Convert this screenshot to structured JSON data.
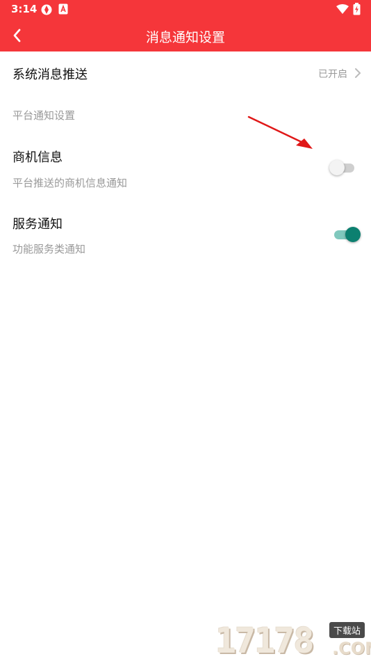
{
  "status_bar": {
    "time": "3:14"
  },
  "app_bar": {
    "title": "消息通知设置"
  },
  "system_push": {
    "label": "系统消息推送",
    "status": "已开启"
  },
  "section": {
    "header": "平台通知设置"
  },
  "business_info": {
    "label": "商机信息",
    "description": "平台推送的商机信息通知",
    "enabled": false
  },
  "service_notice": {
    "label": "服务通知",
    "description": "功能服务类通知",
    "enabled": true
  },
  "colors": {
    "brand": "#f5363a",
    "switch_on": "#0c8070",
    "annotation_arrow": "#e01818"
  },
  "watermark": {
    "digits": "17178",
    "badge": "下载站",
    "suffix": ".COM"
  }
}
